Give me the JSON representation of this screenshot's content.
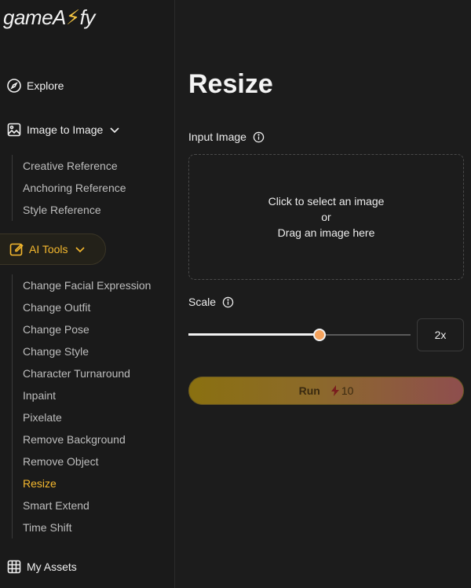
{
  "brand": {
    "name_left": "gameA",
    "name_right": "fy",
    "bolt": "⚡"
  },
  "sidebar": {
    "explore": "Explore",
    "image_to_image": "Image to Image",
    "image_to_image_items": [
      "Creative Reference",
      "Anchoring Reference",
      "Style Reference"
    ],
    "ai_tools": "AI Tools",
    "ai_tools_items": [
      "Change Facial Expression",
      "Change Outfit",
      "Change Pose",
      "Change Style",
      "Character Turnaround",
      "Inpaint",
      "Pixelate",
      "Remove Background",
      "Remove Object",
      "Resize",
      "Smart Extend",
      "Time Shift"
    ],
    "active_item": "Resize",
    "my_assets": "My Assets"
  },
  "main": {
    "title": "Resize",
    "input_label": "Input Image",
    "dropzone": {
      "line1": "Click to select an image",
      "line2": "or",
      "line3": "Drag an image here"
    },
    "scale_label": "Scale",
    "scale_value": "2x",
    "scale_fraction": 0.59,
    "run_label": "Run",
    "run_cost": "10"
  },
  "colors": {
    "accent": "#f5b82e",
    "background": "#1c1c1c",
    "thumb": "#f5a25c"
  },
  "icons": {
    "explore": "compass-icon",
    "image_to_image": "image-icon",
    "ai_tools": "edit-icon",
    "my_assets": "grid-icon",
    "info": "info-icon",
    "chevron": "chevron-down-icon",
    "cost": "lightning-icon"
  }
}
